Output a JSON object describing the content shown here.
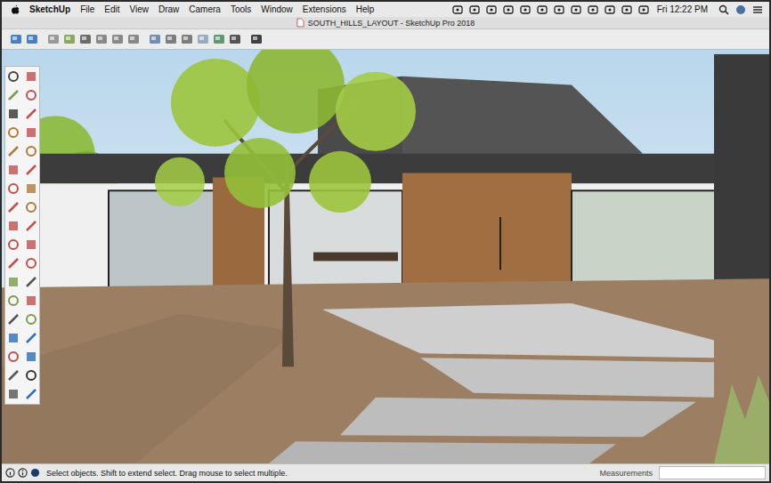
{
  "menu_bar": {
    "app": "SketchUp",
    "items": [
      "File",
      "Edit",
      "View",
      "Draw",
      "Camera",
      "Tools",
      "Window",
      "Extensions",
      "Help"
    ],
    "clock": "Fri 12:22 PM"
  },
  "window": {
    "title": "SOUTH_HILLS_LAYOUT - SketchUp Pro 2018"
  },
  "status_bar": {
    "message": "Select objects. Shift to extend select. Drag mouse to select multiple.",
    "measurements_label": "Measurements"
  }
}
